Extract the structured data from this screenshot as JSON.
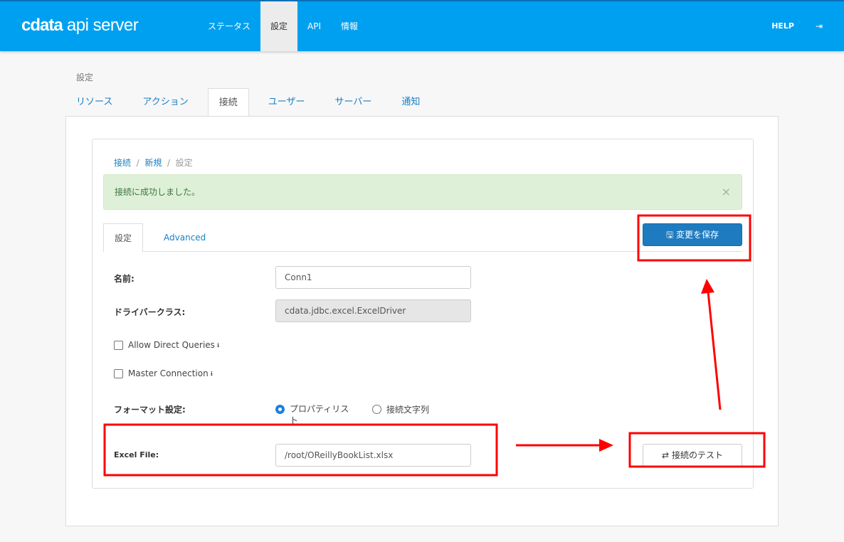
{
  "header": {
    "logo": "cdata api server",
    "nav": [
      "ステータス",
      "設定",
      "API",
      "情報"
    ],
    "active_nav": 1,
    "help": "HELP",
    "logout_icon": "sign-out-icon"
  },
  "page": {
    "breadcrumb": "設定",
    "tabs": [
      "リソース",
      "アクション",
      "接続",
      "ユーザー",
      "サーバー",
      "通知"
    ],
    "active_tab": 2
  },
  "connection": {
    "breadcrumb": {
      "root": "接続",
      "new": "新規",
      "current": "設定"
    },
    "alert": "接続に成功しました。",
    "alert_close": "×",
    "subtabs": [
      "設定",
      "Advanced"
    ],
    "save_label": "変更を保存",
    "fields": {
      "name_label": "名前:",
      "name_value": "Conn1",
      "driver_label": "ドライバークラス:",
      "driver_value": "cdata.jdbc.excel.ExcelDriver",
      "allow_direct": "Allow Direct Queries",
      "master_conn": "Master Connection",
      "format_label": "フォーマット設定:",
      "format_options": [
        "プロパティリスト",
        "接続文字列"
      ],
      "excel_label": "Excel File:",
      "excel_value": "/root/OReillyBookList.xlsx"
    },
    "test_label": "接続のテスト"
  },
  "annotation_color": "#ff0000"
}
